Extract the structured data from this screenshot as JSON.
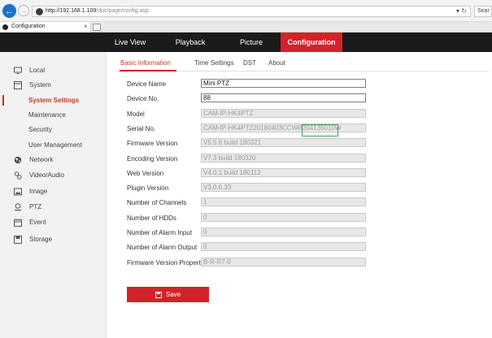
{
  "browser": {
    "url_host": "http://192.168.1.109",
    "url_path": "/doc/page/config.asp",
    "right_controls": "▾ ↻",
    "search_text": "Sear",
    "tab_title": "Configuration",
    "tab_close": "×"
  },
  "top_nav": [
    {
      "label": "Live View",
      "active": false
    },
    {
      "label": "Playback",
      "active": false
    },
    {
      "label": "Picture",
      "active": false
    },
    {
      "label": "Configuration",
      "active": true
    }
  ],
  "sidebar": {
    "items": [
      {
        "label": "Local",
        "icon": "monitor-icon",
        "sub": false,
        "active": false
      },
      {
        "label": "System",
        "icon": "system-icon",
        "sub": false,
        "active": false
      },
      {
        "label": "System Settings",
        "icon": "",
        "sub": true,
        "active": true
      },
      {
        "label": "Maintenance",
        "icon": "",
        "sub": true,
        "active": false
      },
      {
        "label": "Security",
        "icon": "",
        "sub": true,
        "active": false
      },
      {
        "label": "User Management",
        "icon": "",
        "sub": true,
        "active": false
      },
      {
        "label": "Network",
        "icon": "globe-icon",
        "sub": false,
        "active": false
      },
      {
        "label": "Video/Audio",
        "icon": "video-audio-icon",
        "sub": false,
        "active": false
      },
      {
        "label": "Image",
        "icon": "image-icon",
        "sub": false,
        "active": false
      },
      {
        "label": "PTZ",
        "icon": "ptz-icon",
        "sub": false,
        "active": false
      },
      {
        "label": "Event",
        "icon": "event-icon",
        "sub": false,
        "active": false
      },
      {
        "label": "Storage",
        "icon": "storage-icon",
        "sub": false,
        "active": false
      }
    ]
  },
  "subtabs": [
    {
      "label": "Basic Information",
      "active": true
    },
    {
      "label": "Time Settings",
      "active": false
    },
    {
      "label": "DST",
      "active": false
    },
    {
      "label": "About",
      "active": false
    }
  ],
  "fields": [
    {
      "label": "Device Name",
      "value": "Mini PTZ",
      "editable": true
    },
    {
      "label": "Device No.",
      "value": "88",
      "editable": true
    },
    {
      "label": "Model",
      "value": "CAM-IP-HK4PTZ",
      "editable": false
    },
    {
      "label": "Serial No.",
      "value": "CAM-IP-HK4PTZ20180403CCWR204135010W",
      "editable": false
    },
    {
      "label": "Firmware Version",
      "value": "V5.5.6 build 180321",
      "editable": false
    },
    {
      "label": "Encoding Version",
      "value": "V7.3 build 180320",
      "editable": false
    },
    {
      "label": "Web Version",
      "value": "V4.0.1 build 180112",
      "editable": false
    },
    {
      "label": "Plugin Version",
      "value": "V3.0.6.33",
      "editable": false
    },
    {
      "label": "Number of Channels",
      "value": "1",
      "editable": false
    },
    {
      "label": "Number of HDDs",
      "value": "0",
      "editable": false
    },
    {
      "label": "Number of Alarm Input",
      "value": "0",
      "editable": false
    },
    {
      "label": "Number of Alarm Output",
      "value": "0",
      "editable": false
    },
    {
      "label": "Firmware Version Property",
      "value": "B-R-R7-0",
      "editable": false
    }
  ],
  "save_label": "Save",
  "colors": {
    "accent": "#d2232a",
    "header_bg": "#1b1b1b",
    "sidebar_bg": "#f2f2f2",
    "highlight": "#3ba35a"
  }
}
